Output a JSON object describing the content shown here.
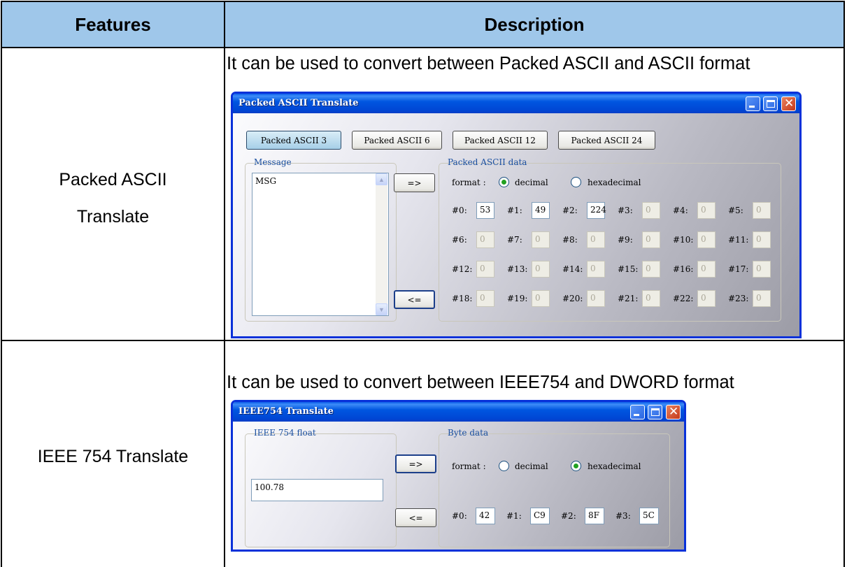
{
  "table": {
    "header": {
      "features": "Features",
      "description": "Description"
    },
    "rows": [
      {
        "feature_line1": "Packed ASCII",
        "feature_line2": "Translate",
        "description": "It can be used to convert between Packed ASCII and ASCII format"
      },
      {
        "feature_line1": "IEEE 754 Translate",
        "description": "It can be used to convert between IEEE754 and DWORD format"
      }
    ]
  },
  "packed": {
    "title": "Packed ASCII Translate",
    "tabs": [
      "Packed ASCII 3",
      "Packed ASCII 6",
      "Packed ASCII 12",
      "Packed ASCII 24"
    ],
    "selected_tab": "Packed ASCII 3",
    "message_legend": "Message",
    "message_value": "MSG",
    "to_right_label": "=>",
    "to_left_label": "<=",
    "data_legend": "Packed ASCII data",
    "format_label": "format :",
    "format_options": [
      "decimal",
      "hexadecimal"
    ],
    "format_selected": "decimal",
    "fields": [
      {
        "label": "#0:",
        "value": "53"
      },
      {
        "label": "#1:",
        "value": "49"
      },
      {
        "label": "#2:",
        "value": "224"
      },
      {
        "label": "#3:",
        "value": "0"
      },
      {
        "label": "#4:",
        "value": "0"
      },
      {
        "label": "#5:",
        "value": "0"
      },
      {
        "label": "#6:",
        "value": "0"
      },
      {
        "label": "#7:",
        "value": "0"
      },
      {
        "label": "#8:",
        "value": "0"
      },
      {
        "label": "#9:",
        "value": "0"
      },
      {
        "label": "#10:",
        "value": "0"
      },
      {
        "label": "#11:",
        "value": "0"
      },
      {
        "label": "#12:",
        "value": "0"
      },
      {
        "label": "#13:",
        "value": "0"
      },
      {
        "label": "#14:",
        "value": "0"
      },
      {
        "label": "#15:",
        "value": "0"
      },
      {
        "label": "#16:",
        "value": "0"
      },
      {
        "label": "#17:",
        "value": "0"
      },
      {
        "label": "#18:",
        "value": "0"
      },
      {
        "label": "#19:",
        "value": "0"
      },
      {
        "label": "#20:",
        "value": "0"
      },
      {
        "label": "#21:",
        "value": "0"
      },
      {
        "label": "#22:",
        "value": "0"
      },
      {
        "label": "#23:",
        "value": "0"
      }
    ]
  },
  "ieee": {
    "title": "IEEE754 Translate",
    "float_legend": "IEEE 754 float",
    "float_value": "100.78",
    "to_right_label": "=>",
    "to_left_label": "<=",
    "byte_legend": "Byte data",
    "format_label": "format :",
    "format_options": [
      "decimal",
      "hexadecimal"
    ],
    "format_selected": "hexadecimal",
    "fields": [
      {
        "label": "#0:",
        "value": "42"
      },
      {
        "label": "#1:",
        "value": "C9"
      },
      {
        "label": "#2:",
        "value": "8F"
      },
      {
        "label": "#3:",
        "value": "5C"
      }
    ]
  }
}
